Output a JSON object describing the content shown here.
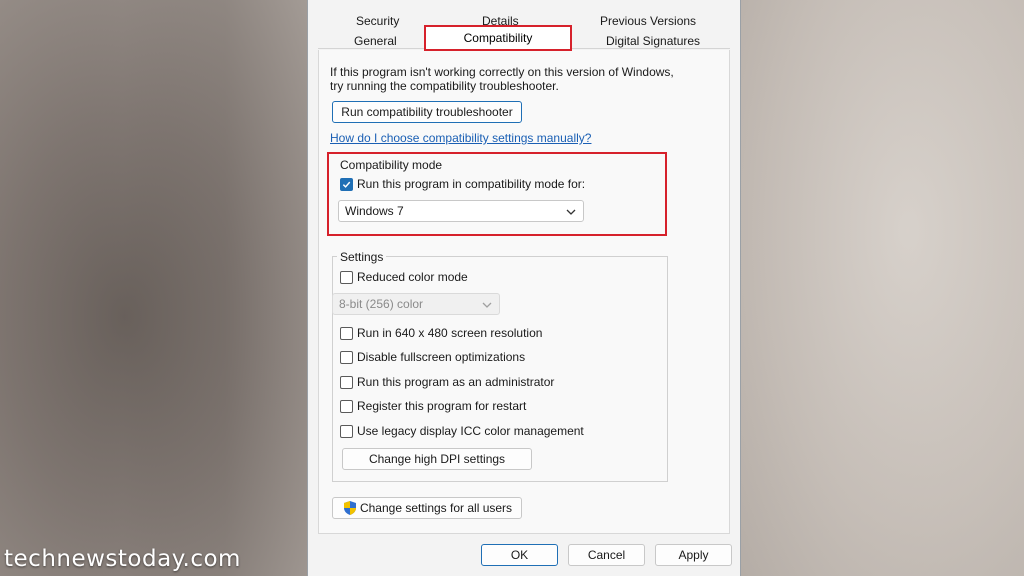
{
  "tabs": {
    "row1": [
      "Security",
      "Details",
      "Previous Versions"
    ],
    "row2": [
      "General",
      "Compatibility",
      "Digital Signatures"
    ]
  },
  "intro": {
    "line1": "If this program isn't working correctly on this version of Windows,",
    "line2": "try running the compatibility troubleshooter."
  },
  "troubleshoot_button": "Run compatibility troubleshooter",
  "help_link": "How do I choose compatibility settings manually?",
  "compat_mode": {
    "title": "Compatibility mode",
    "checkbox_label": "Run this program in compatibility mode for:",
    "checked": true,
    "selected_os": "Windows 7"
  },
  "settings": {
    "title": "Settings",
    "reduced_color": "Reduced color mode",
    "color_depth": "8-bit (256) color",
    "options": [
      "Run in 640 x 480 screen resolution",
      "Disable fullscreen optimizations",
      "Run this program as an administrator",
      "Register this program for restart",
      "Use legacy display ICC color management"
    ],
    "dpi_button": "Change high DPI settings"
  },
  "all_users_button": "Change settings for all users",
  "footer": {
    "ok": "OK",
    "cancel": "Cancel",
    "apply": "Apply"
  },
  "watermark": "technewstoday.com",
  "colors": {
    "highlight": "#d6212b",
    "accent": "#1f6fb5",
    "link": "#1a5fb4"
  }
}
